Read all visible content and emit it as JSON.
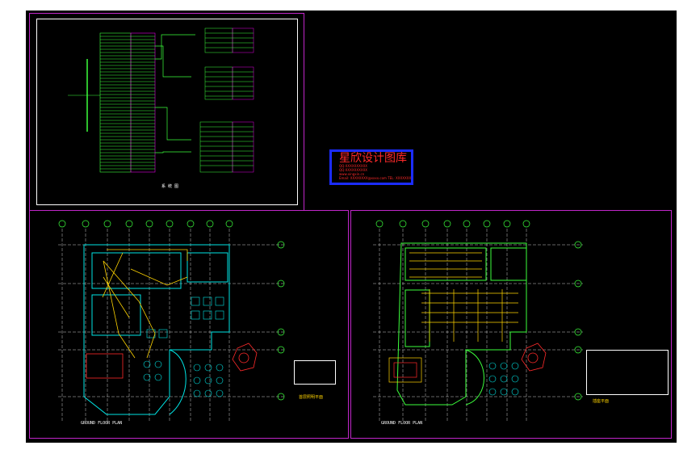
{
  "stamp": {
    "title": "星欣设计图库",
    "lines": [
      "QQ:XXXXXXXXXX",
      "QQ:XXXXXXXXXX",
      "www.xingxin.cn",
      "Email: XXXXXXXX@xxxx.com  TEL: XXXXXXXXX"
    ]
  },
  "sheets": {
    "schematic_caption": "系 统 图",
    "left_plan_caption": "GROUND FLOOR PLAN",
    "left_plan_title": "首层照明平面",
    "right_plan_caption": "GROUND FLOOR PLAN",
    "right_plan_title": "插座平面"
  },
  "colors": {
    "canvas": "#000000",
    "sheet_border": "#c026c9",
    "cyan": "#00e5e5",
    "green": "#3cff3c",
    "yellow": "#ffd400",
    "magenta": "#e000e0",
    "red": "#ff2a2a",
    "blue": "#1b2cff"
  }
}
